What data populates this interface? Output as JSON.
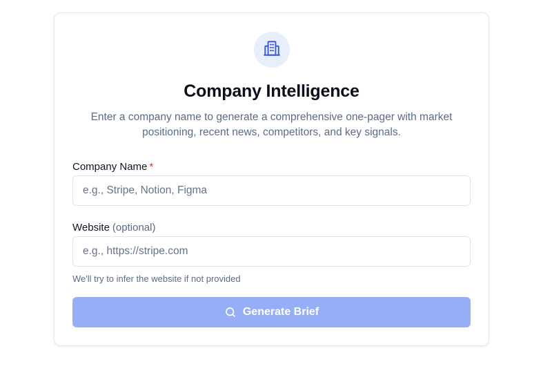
{
  "header": {
    "icon": "building-icon",
    "title": "Company Intelligence",
    "subtitle_line1": "Enter a company name to generate a comprehensive one-pager with market",
    "subtitle_line2": "positioning, recent news, competitors, and key signals."
  },
  "form": {
    "company": {
      "label": "Company Name",
      "required_marker": "*",
      "placeholder": "e.g., Stripe, Notion, Figma",
      "value": ""
    },
    "website": {
      "label": "Website",
      "optional_note": "(optional)",
      "placeholder": "e.g., https://stripe.com",
      "value": "",
      "hint": "We'll try to infer the website if not provided"
    },
    "submit": {
      "icon": "search-icon",
      "label": "Generate Brief",
      "disabled": true
    }
  },
  "colors": {
    "accent": "#3b5bdb",
    "button_disabled": "#96aef5",
    "icon_bg": "#e9eefc",
    "required": "#e0302e"
  }
}
